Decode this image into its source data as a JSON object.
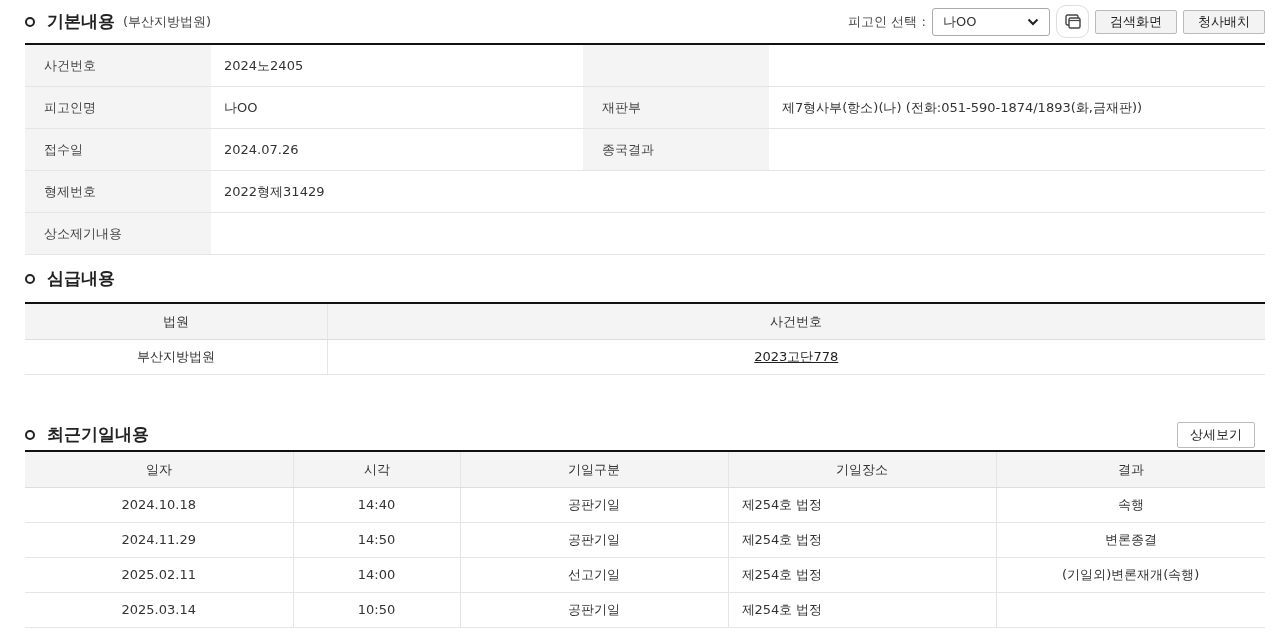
{
  "basic_info": {
    "title": "기본내용",
    "court": "(부산지방법원)",
    "defendant_select": {
      "label": "피고인 선택 :",
      "value": "나OO"
    },
    "buttons": [
      "검색화면",
      "청사배치"
    ],
    "rows": [
      {
        "kind": "pair",
        "label": "사건번호",
        "value": "2024노2405"
      },
      {
        "kind": "pair",
        "label": "피고인명",
        "value": "나OO",
        "label_2": "재판부",
        "value_2": "제7형사부(항소)(나) (전화:051-590-1874/1893(화,금재판))"
      },
      {
        "kind": "pair",
        "label": "접수일",
        "value": "2024.07.26",
        "label_2": "종국결과"
      },
      {
        "kind": "single",
        "label": "형제번호",
        "value": "2022형제31429"
      },
      {
        "kind": "single",
        "label": "상소제기내용"
      }
    ]
  },
  "lower_court": {
    "title": "심급내용",
    "columns": [
      "법원",
      "사건번호"
    ],
    "rows": [
      {
        "court": "부산지방법원",
        "case_number": "2023고단778"
      }
    ]
  },
  "recent_hearings": {
    "title": "최근기일내용",
    "button": "상세보기",
    "columns": [
      "일자",
      "시각",
      "기일구분",
      "기일장소",
      "결과"
    ],
    "rows": [
      {
        "date": "2024.10.18",
        "time": "14:40",
        "type": "공판기일",
        "place": "제254호 법정",
        "result": "속행"
      },
      {
        "date": "2024.11.29",
        "time": "14:50",
        "type": "공판기일",
        "place": "제254호 법정",
        "result": "변론종결"
      },
      {
        "date": "2025.02.11",
        "time": "14:00",
        "type": "선고기일",
        "place": "제254호 법정",
        "result": "(기일외)변론재개(속행)"
      },
      {
        "date": "2025.03.14",
        "time": "10:50",
        "type": "공판기일",
        "place": "제254호 법정"
      }
    ]
  }
}
